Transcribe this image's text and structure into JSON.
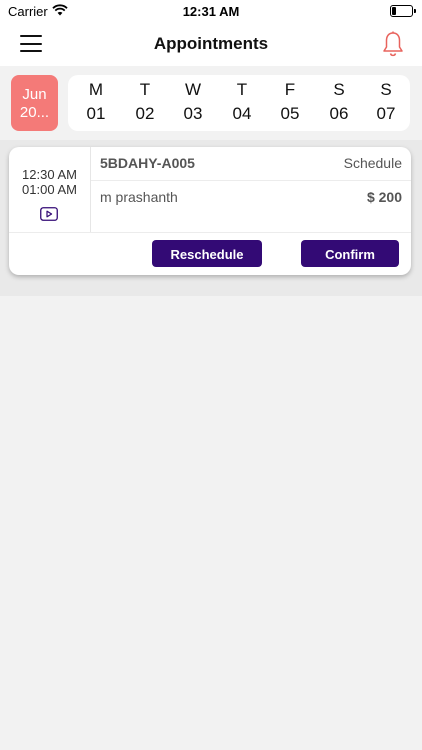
{
  "status_bar": {
    "carrier": "Carrier",
    "time": "12:31 AM"
  },
  "header": {
    "title": "Appointments",
    "menu_icon": "hamburger-menu-icon",
    "bell_icon": "bell-icon",
    "accent": "#e8635d"
  },
  "calendar": {
    "month_label_line1": "Jun",
    "month_label_line2": "20...",
    "month_chip_color": "#f47a78",
    "days": [
      {
        "letter": "M",
        "number": "01"
      },
      {
        "letter": "T",
        "number": "02"
      },
      {
        "letter": "W",
        "number": "03"
      },
      {
        "letter": "T",
        "number": "04"
      },
      {
        "letter": "F",
        "number": "05"
      },
      {
        "letter": "S",
        "number": "06"
      },
      {
        "letter": "S",
        "number": "07"
      }
    ]
  },
  "appointments": [
    {
      "start_time": "12:30 AM",
      "end_time": "01:00 AM",
      "type_icon": "video-play-icon",
      "id": "5BDAHY-A005",
      "status": "Schedule",
      "patient": "m prashanth",
      "price": "$ 200",
      "actions": {
        "reschedule": "Reschedule",
        "confirm": "Confirm"
      }
    }
  ],
  "colors": {
    "primary_button": "#330a75"
  }
}
